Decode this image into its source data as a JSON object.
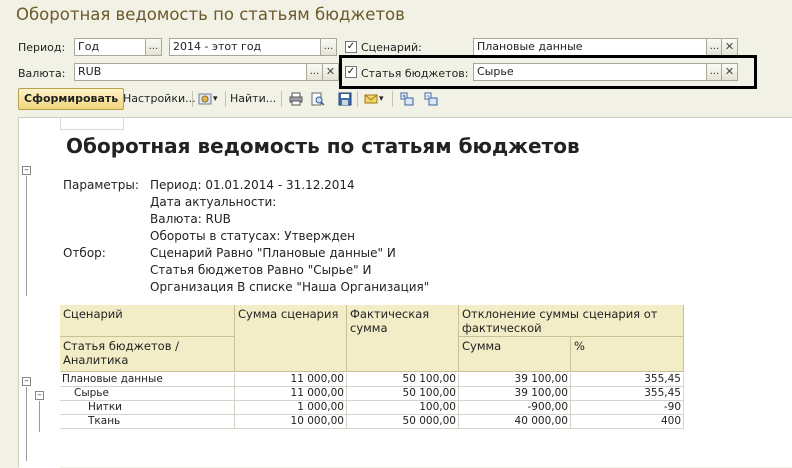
{
  "window": {
    "title": "Оборотная ведомость по статьям бюджетов"
  },
  "form": {
    "period_label": "Период:",
    "period_value": "Год",
    "period_range": "2014 - этот год",
    "currency_label": "Валюта:",
    "currency_value": "RUB",
    "scenario_label": "Сценарий:",
    "scenario_checked": true,
    "scenario_value": "Плановые данные",
    "budget_item_label": "Статья бюджетов:",
    "budget_item_checked": true,
    "budget_item_value": "Сырье",
    "ellipsis": "...",
    "clear": "✕"
  },
  "toolbar": {
    "generate": "Сформировать",
    "settings": "Настройки...",
    "find": "Найти...",
    "icons": [
      "settings-variant-icon",
      "print-icon",
      "preview-icon",
      "save-icon",
      "mail-icon",
      "expand-icon",
      "collapse-icon"
    ]
  },
  "report": {
    "title": "Оборотная ведомость по статьям бюджетов",
    "params_label": "Параметры:",
    "params": [
      "Период: 01.01.2014 - 31.12.2014",
      "Дата актуальности:",
      "Валюта: RUB",
      "Обороты в статусах: Утвержден"
    ],
    "filter_label": "Отбор:",
    "filter": [
      "Сценарий Равно \"Плановые данные\" И",
      "Статья бюджетов Равно \"Сырье\" И",
      "Организация В списке \"Наша Организация\""
    ],
    "table": {
      "header_scenario": "Сценарий",
      "header_item": "Статья бюджетов /\nАналитика",
      "header_sum": "Сумма сценария",
      "header_fact": "Фактическая\nсумма",
      "header_dev": "Отклонение суммы сценария от\nфактической",
      "header_dev_sum": "Сумма",
      "header_dev_pct": "%",
      "rows": [
        {
          "name": "Плановые данные",
          "sum": "11 000,00",
          "fact": "50 100,00",
          "dev": "39 100,00",
          "pct": "355,45"
        },
        {
          "name": "Сырье",
          "sum": "11 000,00",
          "fact": "50 100,00",
          "dev": "39 100,00",
          "pct": "355,45"
        },
        {
          "name": "Нитки",
          "sum": "1 000,00",
          "fact": "100,00",
          "dev": "-900,00",
          "pct": "-90"
        },
        {
          "name": "Ткань",
          "sum": "10 000,00",
          "fact": "50 000,00",
          "dev": "40 000,00",
          "pct": "400"
        }
      ]
    }
  },
  "colors": {
    "title": "#6b5a2a",
    "header_bg": "#f2ecc7",
    "highlight_border": "#000000"
  }
}
